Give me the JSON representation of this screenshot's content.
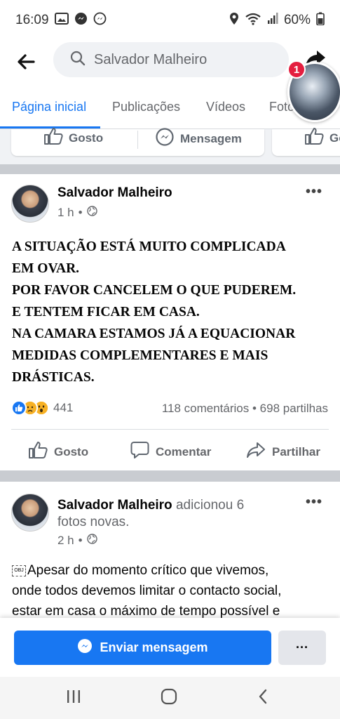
{
  "status": {
    "time": "16:09",
    "battery": "60%",
    "icons": [
      "gallery-icon",
      "messenger-icon",
      "messenger-outline-icon",
      "location-icon",
      "wifi-icon",
      "signal-icon",
      "battery-icon"
    ]
  },
  "header": {
    "search_text": "Salvador Malheiro",
    "chat_head_badge": "1"
  },
  "tabs": [
    {
      "label": "Página inicial",
      "active": true
    },
    {
      "label": "Publicações",
      "active": false
    },
    {
      "label": "Vídeos",
      "active": false
    },
    {
      "label": "Foto",
      "active": false
    }
  ],
  "top_actions": {
    "like": "Gosto",
    "message": "Mensagem",
    "like_partial": "Go"
  },
  "posts": [
    {
      "author": "Salvador Malheiro",
      "time": "1 h",
      "body_lines": [
        "A SITUAÇÃO ESTÁ MUITO COMPLICADA",
        "EM OVAR.",
        "POR FAVOR CANCELEM O QUE PUDEREM.",
        "E TENTEM FICAR EM CASA.",
        "NA CAMARA ESTAMOS JÁ A EQUACIONAR",
        "MEDIDAS COMPLEMENTARES E MAIS",
        "DRÁSTICAS."
      ],
      "reaction_count": "441",
      "comments": "118 comentários",
      "shares": "698 partilhas",
      "actions": {
        "like": "Gosto",
        "comment": "Comentar",
        "share": "Partilhar"
      }
    },
    {
      "author": "Salvador Malheiro",
      "author_suffix": "adicionou 6",
      "author_suffix2": "fotos novas.",
      "time": "2 h",
      "body_lines": [
        "Apesar do momento crítico que vivemos,",
        "onde todos devemos limitar o contacto social,",
        "estar em casa o máximo de tempo possível e"
      ]
    }
  ],
  "bottom": {
    "send_message": "Enviar mensagem",
    "more": "···"
  },
  "colors": {
    "brand_blue": "#1877f2",
    "badge_red": "#e41e3f",
    "text_secondary": "#65676b"
  }
}
